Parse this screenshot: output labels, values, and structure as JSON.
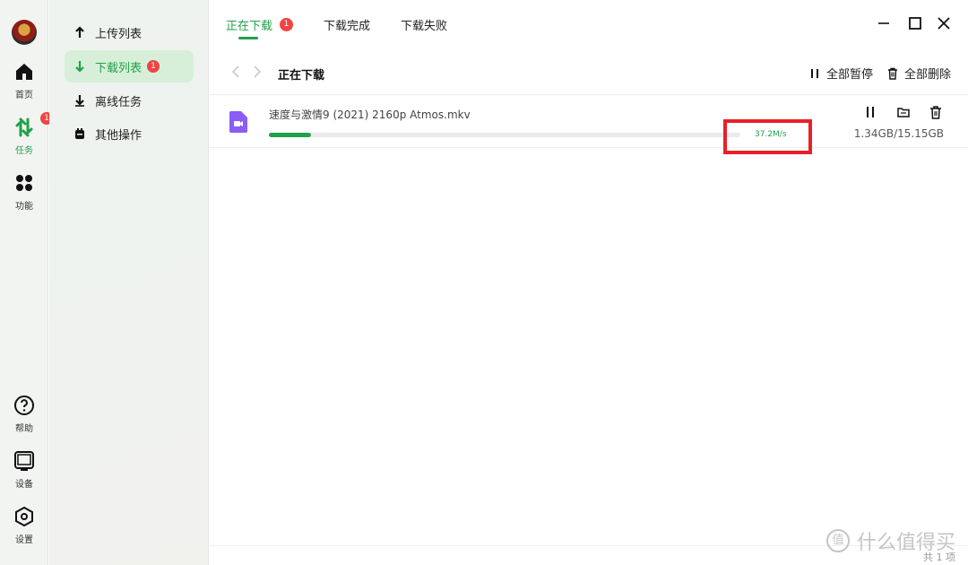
{
  "rail": {
    "items": [
      {
        "label": "首页",
        "icon": "home-icon"
      },
      {
        "label": "任务",
        "icon": "task-transfer-icon",
        "badge": "1"
      },
      {
        "label": "功能",
        "icon": "apps-grid-icon"
      },
      {
        "label": "帮助",
        "icon": "help-icon"
      },
      {
        "label": "设备",
        "icon": "device-icon"
      },
      {
        "label": "设置",
        "icon": "settings-icon"
      }
    ]
  },
  "sidebar": {
    "items": [
      {
        "label": "上传列表",
        "icon": "upload-arrow-icon"
      },
      {
        "label": "下载列表",
        "icon": "download-arrow-icon",
        "badge": "1"
      },
      {
        "label": "离线任务",
        "icon": "offline-download-icon"
      },
      {
        "label": "其他操作",
        "icon": "other-ops-icon"
      }
    ]
  },
  "tabs": [
    {
      "label": "正在下载",
      "badge": "1"
    },
    {
      "label": "下载完成"
    },
    {
      "label": "下载失败"
    }
  ],
  "toolbar": {
    "title": "正在下载",
    "pause_all": "全部暂停",
    "delete_all": "全部删除"
  },
  "downloads": [
    {
      "name": "速度与激情9 (2021) 2160p Atmos.mkv",
      "speed": "37.2M/s",
      "size": "1.34GB/15.15GB",
      "progress": 0.0885
    }
  ],
  "footer": {
    "count": "共 1 项"
  },
  "watermark": {
    "text": "什么值得买",
    "mark": "值"
  },
  "colors": {
    "accent": "#21a14a",
    "badge": "#f04444",
    "highlight": "#e8202a",
    "file_icon": "#8b5cf6"
  }
}
